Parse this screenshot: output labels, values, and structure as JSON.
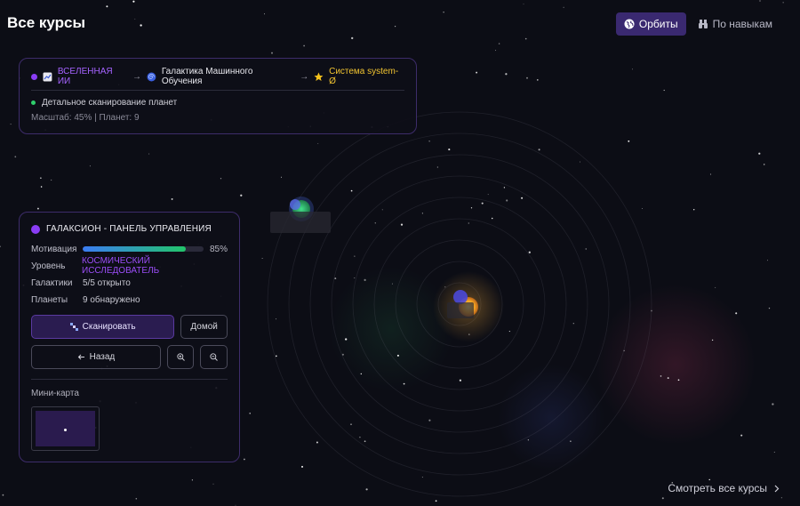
{
  "header": {
    "title": "Все курсы",
    "tabs": [
      {
        "label": "Орбиты",
        "icon": "globe-icon",
        "active": true
      },
      {
        "label": "По навыкам",
        "icon": "binoculars-icon",
        "active": false
      }
    ]
  },
  "breadcrumb": {
    "universe": "ВСЕЛЕННАЯ ИИ",
    "galaxy": "Галактика Машинного Обучения",
    "system": "Система system-Ø",
    "arrow": "→",
    "scan_status": "Детальное сканирование планет",
    "scale_info": "Масштаб: 45% | Планет: 9"
  },
  "control_panel": {
    "title": "ГАЛАКСИОН - ПАНЕЛЬ УПРАВЛЕНИЯ",
    "motivation_label": "Мотивация",
    "motivation_value": 0.85,
    "motivation_text": "85%",
    "level_label": "Уровень",
    "level_value": "КОСМИЧЕСКИЙ ИССЛЕДОВАТЕЛЬ",
    "galaxies_label": "Галактики",
    "galaxies_value": "5/5 открыто",
    "planets_label": "Планеты",
    "planets_value": "9 обнаружено",
    "scan_button": "Сканировать",
    "home_button": "Домой",
    "back_button": "Назад",
    "minimap_label": "Мини-карта"
  },
  "footer": {
    "see_all": "Смотреть все курсы"
  },
  "colors": {
    "accent": "#3a2970",
    "universe": "#a563ff",
    "system": "#f3c531",
    "level": "#9b4df8"
  }
}
